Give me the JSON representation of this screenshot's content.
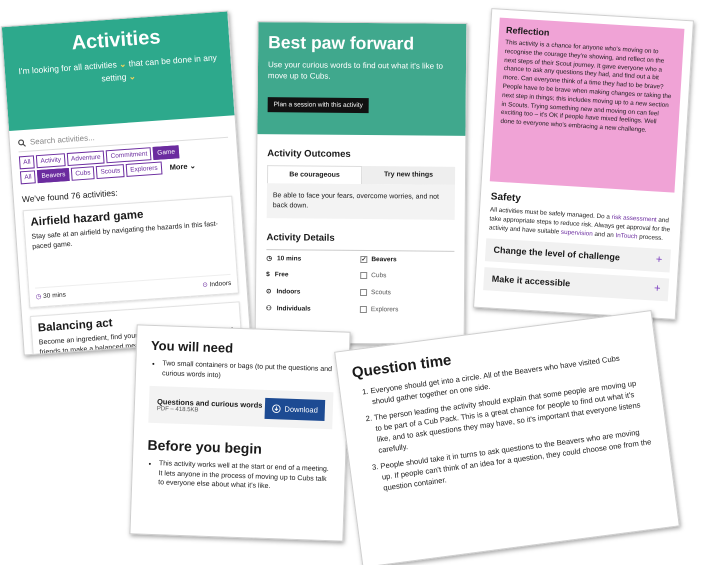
{
  "activities": {
    "title": "Activities",
    "intro_prefix": "I'm looking for all activities",
    "intro_mid": "that can be done in any setting",
    "chevron": "⌄",
    "search_placeholder": "Search activities...",
    "type_filters": [
      "All",
      "Activity",
      "Adventure",
      "Commitment",
      "Game"
    ],
    "section_filters": [
      "All",
      "Beavers",
      "Cubs",
      "Scouts",
      "Explorers"
    ],
    "more_label": "More",
    "found_text": "We've found 76 activities:",
    "cards": [
      {
        "title": "Airfield hazard game",
        "desc": "Stay safe at an airfield by navigating the hazards in this fast-paced game.",
        "time": "30 mins",
        "location": "Indoors"
      },
      {
        "title": "Balancing act",
        "desc": "Become an ingredient, find your food group, then join with your friends to make a balanced meal."
      }
    ],
    "colors": {
      "hero": "#2da98c",
      "accent": "#6b2c9f"
    }
  },
  "paw": {
    "title": "Best paw forward",
    "subtitle": "Use your curious words to find out what it's like to move up to Cubs.",
    "plan_button": "Plan a session with this activity",
    "outcomes_heading": "Activity Outcomes",
    "tabs": [
      "Be courageous",
      "Try new things"
    ],
    "tab_text": "Be able to face your fears, overcome worries, and not back down.",
    "details_heading": "Activity Details",
    "details": [
      "10 mins",
      "Free",
      "Indoors",
      "Individuals"
    ],
    "sections": [
      {
        "label": "Beavers",
        "checked": true
      },
      {
        "label": "Cubs",
        "checked": false
      },
      {
        "label": "Scouts",
        "checked": false
      },
      {
        "label": "Explorers",
        "checked": false
      }
    ]
  },
  "reflection": {
    "heading": "Reflection",
    "text": "This activity is a chance for anyone who's moving on to recognise the courage they're showing, and reflect on the next steps of their Scout journey. It gave everyone who a chance to ask any questions they had, and find out a bit more. Can everyone think of a time they had to be brave? People have to be brave when making changes or taking the next step in things; this includes moving up to a new section in Scouts. Trying something new and moving on can feel exciting too – it's OK if people have mixed feelings. Well done to everyone who's embracing a new challenge.",
    "safety_heading": "Safety",
    "safety_a": "All activities must be safely managed. Do a",
    "safety_link1": "risk assessment",
    "safety_b": "and take appropriate steps to reduce risk. Always get approval for the activity and have suitable",
    "safety_link2": "supervision",
    "safety_c": "and an",
    "safety_link3": "InTouch",
    "safety_d": "process.",
    "accordions": [
      "Change the level of challenge",
      "Make it accessible"
    ],
    "plus": "+"
  },
  "need": {
    "heading": "You will need",
    "item": "Two small containers or bags (to put the questions and curious words into)",
    "file_title": "Questions and curious words",
    "file_meta": "PDF – 418.5KB",
    "download": "Download",
    "before_heading": "Before you begin",
    "before_text": "This activity works well at the start or end of a meeting. It lets anyone in the process of moving up to Cubs talk to everyone else about what it's like."
  },
  "question": {
    "heading": "Question time",
    "steps": [
      "Everyone should get into a circle. All of the Beavers who have visited Cubs should gather together on one side.",
      "The person leading the activity should explain that some people are moving up to be part of a Cub Pack. This is a great chance for people to find out what it's like, and to ask questions they may have, so it's important that everyone listens carefully.",
      "People should take it in turns to ask questions to the Beavers who are moving up. If people can't think of an idea for a question, they could choose one from the question container."
    ]
  }
}
